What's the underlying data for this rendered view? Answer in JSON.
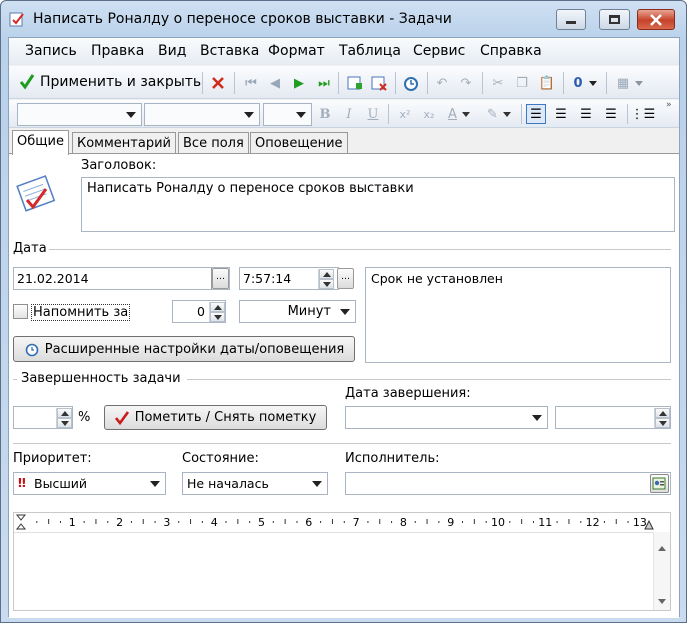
{
  "window": {
    "title": "Написать Роналду о переносе сроков выставки - Задачи"
  },
  "menu": [
    "Запись",
    "Правка",
    "Вид",
    "Вставка",
    "Формат",
    "Таблица",
    "Сервис",
    "Справка"
  ],
  "toolbar": {
    "apply_close_label": "Применить и закрыть"
  },
  "tabs": [
    "Общие",
    "Комментарий",
    "Все поля",
    "Оповещение"
  ],
  "general": {
    "subject_label": "Заголовок:",
    "subject_value": "Написать Роналду о переносе сроков выставки",
    "date_group_label": "Дата",
    "date_value": "21.02.2014",
    "time_value": "7:57:14",
    "deadline_text": "Срок не установлен",
    "remind_label": "Напомнить за",
    "remind_count": "0",
    "remind_unit": "Минут",
    "advanced_button": "Расширенные настройки даты/оповещения",
    "completion_group_label": "Завершенность задачи",
    "percent_sign": "%",
    "mark_button": "Пометить / Снять пометку",
    "completion_date_label": "Дата завершения:",
    "priority_label": "Приоритет:",
    "priority_value": "Высший",
    "state_label": "Состояние:",
    "state_value": "Не началась",
    "assignee_label": "Исполнитель:"
  },
  "ruler": {
    "ticks": [
      "1",
      "2",
      "3",
      "4",
      "5",
      "6",
      "7",
      "8",
      "9",
      "10",
      "11",
      "12",
      "13"
    ]
  },
  "colors": {
    "accent_green": "#1f9d1f",
    "delete_red": "#d02a1c",
    "priority_red": "#cc1111",
    "check_red": "#c81d1d"
  }
}
